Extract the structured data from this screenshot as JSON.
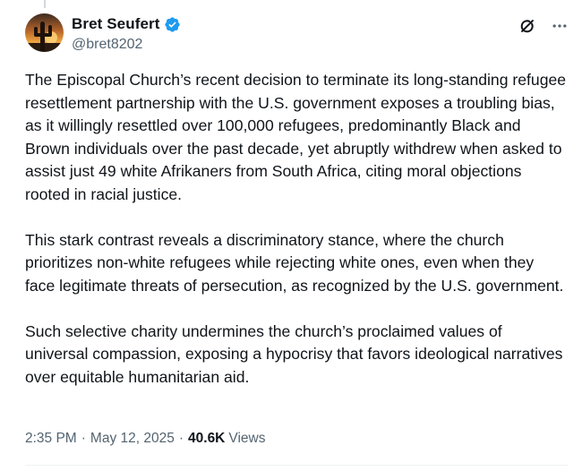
{
  "author": {
    "display_name": "Bret Seufert",
    "handle": "@bret8202",
    "verified_icon": "verified-badge-icon",
    "badge_color": "#1d9bf0"
  },
  "actions": {
    "grok_icon": "grok-icon",
    "more_icon": "more-options-icon"
  },
  "post": {
    "paragraphs": [
      "The Episcopal Church’s recent decision to terminate its long-standing refugee resettlement partnership with the U.S. government exposes a troubling bias, as it willingly resettled over 100,000 refugees, predominantly Black and Brown individuals over the past decade, yet abruptly withdrew when asked to assist just 49 white Afrikaners from South Africa, citing moral objections rooted in racial justice.",
      "This stark contrast reveals a discriminatory stance, where the church prioritizes non-white refugees while rejecting white ones, even when they face legitimate threats of persecution, as recognized by the U.S. government.",
      "Such selective charity undermines the church’s proclaimed values of universal compassion, exposing a hypocrisy that favors ideological narratives over equitable humanitarian aid."
    ]
  },
  "meta": {
    "time": "2:35 PM",
    "separator": "·",
    "date": "May 12, 2025",
    "views_count": "40.6K",
    "views_label": "Views"
  }
}
